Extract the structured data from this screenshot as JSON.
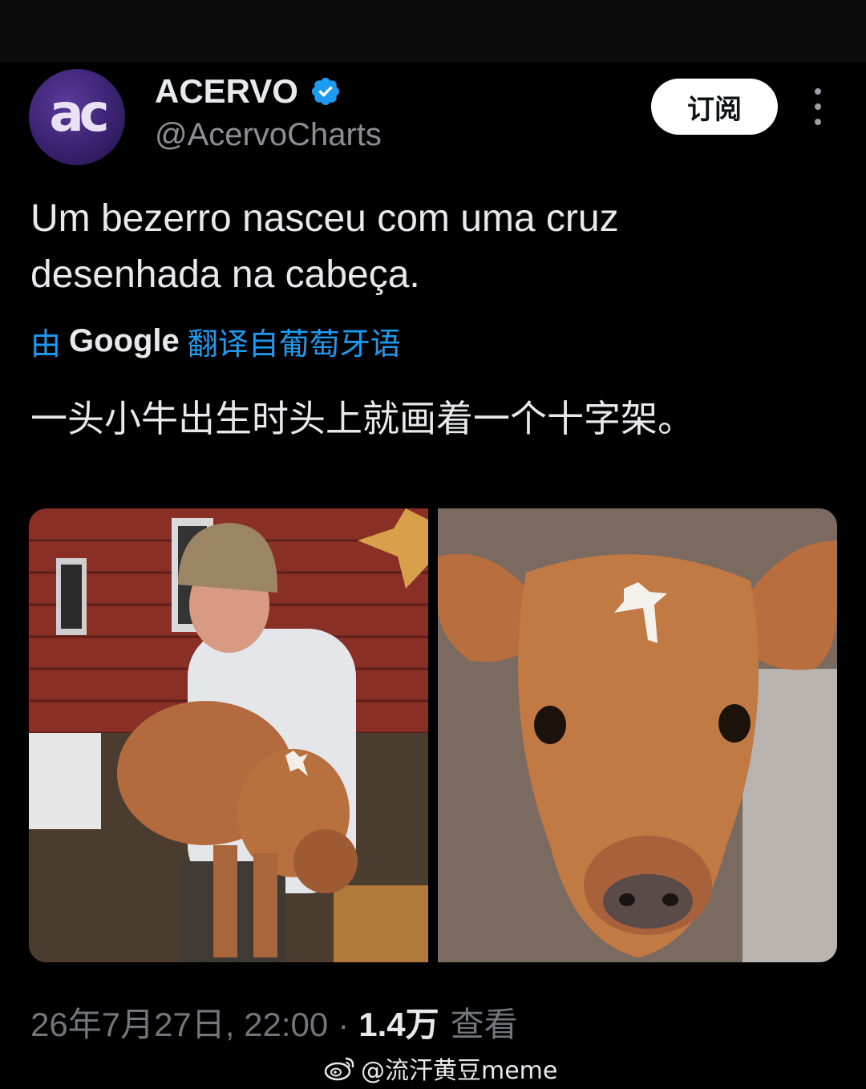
{
  "account": {
    "avatar_text": "ac",
    "display_name": "ACERVO",
    "handle": "@AcervoCharts",
    "verified_icon": "verified-badge-icon"
  },
  "actions": {
    "subscribe_label": "订阅",
    "more_icon": "more-vertical-icon"
  },
  "tweet": {
    "text_line1": "Um bezerro nasceu com uma cruz",
    "text_line2": "desenhada na cabeça.",
    "translate_prefix": "由",
    "translate_brand": "Google",
    "translate_suffix": "翻译自葡萄牙语",
    "translated_text": "一头小牛出生时头上就画着一个十字架。"
  },
  "media": {
    "photo_left": "man-holding-calf-photo",
    "photo_right": "calf-closeup-photo"
  },
  "meta": {
    "date": "26年7月27日, 22:00",
    "dot": "·",
    "views_count": "1.4万",
    "views_label": "查看"
  },
  "watermark": {
    "icon": "weibo-icon",
    "text": "@流汗黄豆meme"
  },
  "colors": {
    "background": "#000000",
    "link": "#1d9bf0",
    "verified": "#1d9bf0",
    "muted": "#71767b"
  }
}
